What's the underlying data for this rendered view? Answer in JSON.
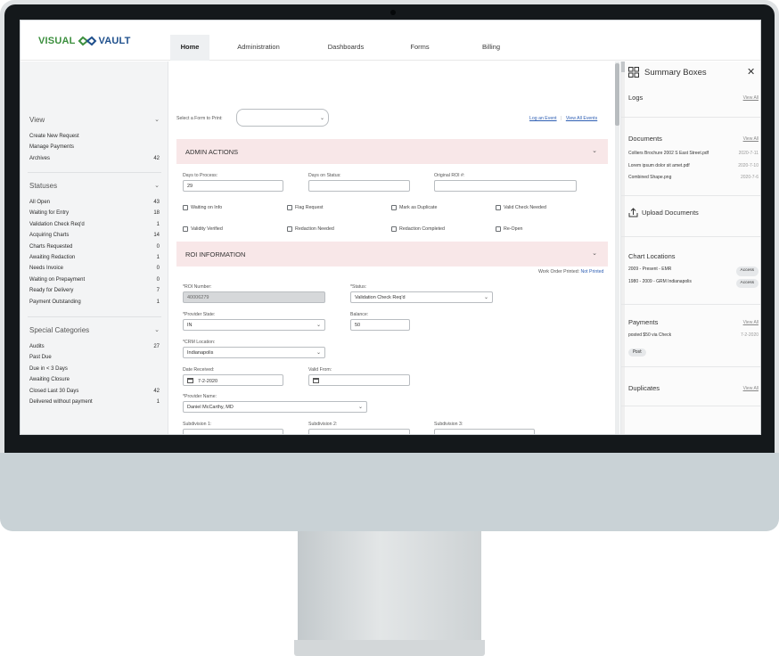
{
  "app": {
    "logo_left": "VISUAL",
    "logo_right": "VAULT",
    "nav": [
      {
        "label": "Home",
        "active": true
      },
      {
        "label": "Administration",
        "active": false
      },
      {
        "label": "Dashboards",
        "active": false
      },
      {
        "label": "Forms",
        "active": false
      },
      {
        "label": "Billing",
        "active": false
      }
    ]
  },
  "sidebar": {
    "view": {
      "title": "View",
      "items": [
        {
          "label": "Create New Request",
          "count": ""
        },
        {
          "label": "Manage Payments",
          "count": ""
        },
        {
          "label": "Archives",
          "count": "42"
        }
      ]
    },
    "statuses": {
      "title": "Statuses",
      "items": [
        {
          "label": "All Open",
          "count": "43"
        },
        {
          "label": "Waiting for Entry",
          "count": "18"
        },
        {
          "label": "Validation Check Req'd",
          "count": "1"
        },
        {
          "label": "Acquiring Charts",
          "count": "14"
        },
        {
          "label": "Charts Requested",
          "count": "0"
        },
        {
          "label": "Awaiting Redaction",
          "count": "1"
        },
        {
          "label": "Needs Invoice",
          "count": "0"
        },
        {
          "label": "Waiting on Prepayment",
          "count": "0"
        },
        {
          "label": "Ready for Delivery",
          "count": "7"
        },
        {
          "label": "Payment Outstanding",
          "count": "1"
        }
      ]
    },
    "special": {
      "title": "Special Categories",
      "items": [
        {
          "label": "Audits",
          "count": "27"
        },
        {
          "label": "Past Due",
          "count": ""
        },
        {
          "label": "Due in < 3 Days",
          "count": ""
        },
        {
          "label": "Awaiting Closure",
          "count": ""
        },
        {
          "label": "Closed Last 30 Days",
          "count": "42"
        },
        {
          "label": "Delivered without payment",
          "count": "1"
        }
      ]
    }
  },
  "main": {
    "print_label": "Select a Form to Print:",
    "print_value": "",
    "log_event": "Log an Event",
    "view_all_events": "View All Events",
    "admin": {
      "title": "ADMIN ACTIONS",
      "days_to_process_label": "Days to Process:",
      "days_to_process_value": "29",
      "days_on_status_label": "Days on Status:",
      "days_on_status_value": "",
      "original_roi_label": "Original ROI #:",
      "original_roi_value": "",
      "checks": [
        "Waiting on Info",
        "Flag Request",
        "Mark as Duplicate",
        "Valid Check Needed",
        "Validity Verified",
        "Redaction Needed",
        "Redaction Completed",
        "Re-Open"
      ]
    },
    "roi": {
      "title": "ROI INFORMATION",
      "work_order_label": "Work Order Printed:",
      "work_order_value": "Not Printed",
      "roi_number_label": "*ROI Number:",
      "roi_number_value": "40006279",
      "status_label": "*Status:",
      "status_value": "Validation Check Req'd",
      "provider_state_label": "*Provider State:",
      "provider_state_value": "IN",
      "balance_label": "Balance:",
      "balance_value": "50",
      "crm_location_label": "*CRM Location:",
      "crm_location_value": "Indianapolis",
      "date_received_label": "Date Received:",
      "date_received_value": "7-2-2020",
      "valid_from_label": "Valid From:",
      "valid_from_value": "",
      "provider_name_label": "*Provider Name:",
      "provider_name_value": "Daniel McCarthy, MD",
      "subdivision_1_label": "Subdivision 1:",
      "subdivision_2_label": "Subdivision 2:",
      "subdivision_3_label": "Subdivision 3:"
    }
  },
  "summary": {
    "title": "Summary Boxes",
    "view_all": "View All",
    "logs_title": "Logs",
    "documents_title": "Documents",
    "documents": [
      {
        "name": "Colliers Brochure 2002 S East Street.pdf",
        "date": "2020-7-11"
      },
      {
        "name": "Lorem ipsum dolor sit amet.pdf",
        "date": "2020-7-10"
      },
      {
        "name": "Combined Shape.png",
        "date": "2020-7-6"
      }
    ],
    "upload_label": "Upload Documents",
    "chart_locations_title": "Chart Locations",
    "chart_locations": [
      {
        "name": "2009 - Present - EMR",
        "action": "Access"
      },
      {
        "name": "1980 - 2009 - GRM Indianapolis",
        "action": "Access"
      }
    ],
    "payments_title": "Payments",
    "payment_text": "posted $50 via Check",
    "payment_date": "7-2-2020",
    "payment_tag": "Post",
    "duplicates_title": "Duplicates"
  },
  "colors": {
    "section_bar": "#f8e7e8",
    "logo_green": "#3c8f3e",
    "logo_blue": "#1e4f8c",
    "link_blue": "#2f5fb3"
  }
}
